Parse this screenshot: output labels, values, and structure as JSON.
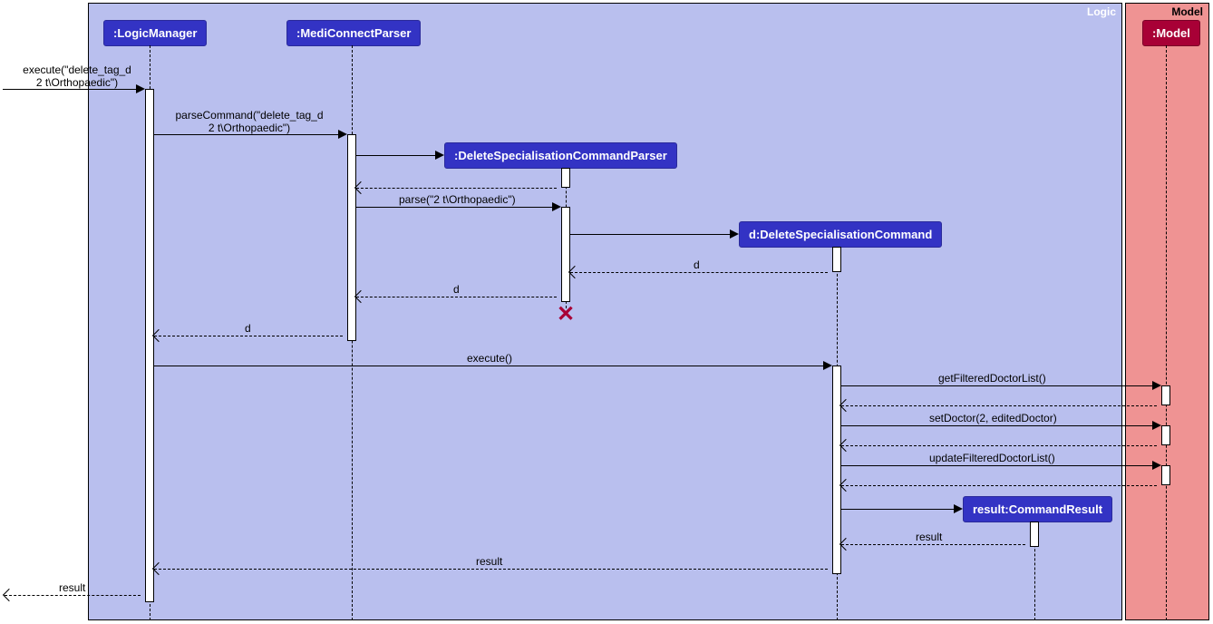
{
  "regions": {
    "logic": "Logic",
    "model": "Model"
  },
  "participants": {
    "logicManager": ":LogicManager",
    "mediConnectParser": ":MediConnectParser",
    "deleteSpecialisationCommandParser": ":DeleteSpecialisationCommandParser",
    "deleteSpecialisationCommand": "d:DeleteSpecialisationCommand",
    "commandResult": "result:CommandResult",
    "model": ":Model"
  },
  "messages": {
    "execute_in": "execute(\"delete_tag_d\n2 t\\Orthopaedic\")",
    "parseCommand": "parseCommand(\"delete_tag_d\n2 t\\Orthopaedic\")",
    "parse": "parse(\"2 t\\Orthopaedic\")",
    "d1": "d",
    "d2": "d",
    "d3": "d",
    "execute": "execute()",
    "getFilteredDoctorList": "getFilteredDoctorList()",
    "setDoctor": "setDoctor(2, editedDoctor)",
    "updateFilteredDoctorList": "updateFilteredDoctorList()",
    "resultReturn1": "result",
    "resultReturn2": "result",
    "resultOut": "result"
  },
  "chart_data": {
    "type": "sequence-diagram",
    "regions": [
      {
        "name": "Logic",
        "color": "#B9BFEE"
      },
      {
        "name": "Model",
        "color": "#EF9393"
      }
    ],
    "participants": [
      {
        "id": "caller",
        "region": null
      },
      {
        "id": "LogicManager",
        "label": ":LogicManager",
        "region": "Logic"
      },
      {
        "id": "MediConnectParser",
        "label": ":MediConnectParser",
        "region": "Logic"
      },
      {
        "id": "DeleteSpecialisationCommandParser",
        "label": ":DeleteSpecialisationCommandParser",
        "region": "Logic",
        "created": true,
        "destroyed": true
      },
      {
        "id": "DeleteSpecialisationCommand",
        "label": "d:DeleteSpecialisationCommand",
        "region": "Logic",
        "created": true
      },
      {
        "id": "CommandResult",
        "label": "result:CommandResult",
        "region": "Logic",
        "created": true
      },
      {
        "id": "Model",
        "label": ":Model",
        "region": "Model"
      }
    ],
    "messages": [
      {
        "from": "caller",
        "to": "LogicManager",
        "label": "execute(\"delete_tag_d 2 t\\Orthopaedic\")",
        "type": "sync"
      },
      {
        "from": "LogicManager",
        "to": "MediConnectParser",
        "label": "parseCommand(\"delete_tag_d 2 t\\Orthopaedic\")",
        "type": "sync"
      },
      {
        "from": "MediConnectParser",
        "to": "DeleteSpecialisationCommandParser",
        "label": "",
        "type": "create"
      },
      {
        "from": "DeleteSpecialisationCommandParser",
        "to": "MediConnectParser",
        "label": "",
        "type": "return"
      },
      {
        "from": "MediConnectParser",
        "to": "DeleteSpecialisationCommandParser",
        "label": "parse(\"2 t\\Orthopaedic\")",
        "type": "sync"
      },
      {
        "from": "DeleteSpecialisationCommandParser",
        "to": "DeleteSpecialisationCommand",
        "label": "",
        "type": "create"
      },
      {
        "from": "DeleteSpecialisationCommand",
        "to": "DeleteSpecialisationCommandParser",
        "label": "d",
        "type": "return"
      },
      {
        "from": "DeleteSpecialisationCommandParser",
        "to": "MediConnectParser",
        "label": "d",
        "type": "return"
      },
      {
        "from": "DeleteSpecialisationCommandParser",
        "to": null,
        "label": "",
        "type": "destroy"
      },
      {
        "from": "MediConnectParser",
        "to": "LogicManager",
        "label": "d",
        "type": "return"
      },
      {
        "from": "LogicManager",
        "to": "DeleteSpecialisationCommand",
        "label": "execute()",
        "type": "sync"
      },
      {
        "from": "DeleteSpecialisationCommand",
        "to": "Model",
        "label": "getFilteredDoctorList()",
        "type": "sync"
      },
      {
        "from": "Model",
        "to": "DeleteSpecialisationCommand",
        "label": "",
        "type": "return"
      },
      {
        "from": "DeleteSpecialisationCommand",
        "to": "Model",
        "label": "setDoctor(2, editedDoctor)",
        "type": "sync"
      },
      {
        "from": "Model",
        "to": "DeleteSpecialisationCommand",
        "label": "",
        "type": "return"
      },
      {
        "from": "DeleteSpecialisationCommand",
        "to": "Model",
        "label": "updateFilteredDoctorList()",
        "type": "sync"
      },
      {
        "from": "Model",
        "to": "DeleteSpecialisationCommand",
        "label": "",
        "type": "return"
      },
      {
        "from": "DeleteSpecialisationCommand",
        "to": "CommandResult",
        "label": "",
        "type": "create"
      },
      {
        "from": "CommandResult",
        "to": "DeleteSpecialisationCommand",
        "label": "result",
        "type": "return"
      },
      {
        "from": "DeleteSpecialisationCommand",
        "to": "LogicManager",
        "label": "result",
        "type": "return"
      },
      {
        "from": "LogicManager",
        "to": "caller",
        "label": "result",
        "type": "return"
      }
    ]
  }
}
